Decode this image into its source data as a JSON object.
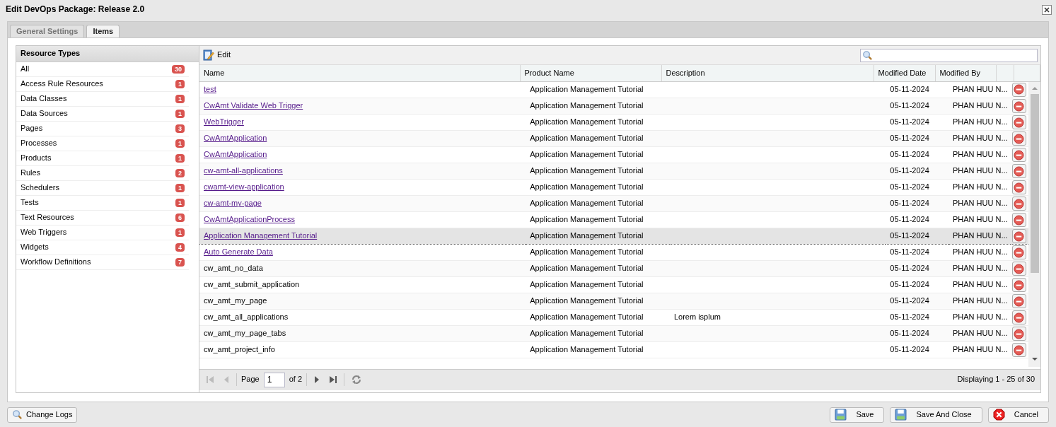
{
  "window": {
    "title": "Edit DevOps Package: Release 2.0"
  },
  "tabs": [
    {
      "label": "General Settings",
      "selected": false
    },
    {
      "label": "Items",
      "selected": true
    }
  ],
  "resource_types": {
    "title": "Resource Types",
    "items": [
      {
        "label": "All",
        "count": "30",
        "selected": false
      },
      {
        "label": "Access Rule Resources",
        "count": "1",
        "selected": false
      },
      {
        "label": "Data Classes",
        "count": "1",
        "selected": false
      },
      {
        "label": "Data Sources",
        "count": "1",
        "selected": false
      },
      {
        "label": "Pages",
        "count": "3",
        "selected": false
      },
      {
        "label": "Processes",
        "count": "1",
        "selected": false
      },
      {
        "label": "Products",
        "count": "1",
        "selected": false
      },
      {
        "label": "Rules",
        "count": "2",
        "selected": false
      },
      {
        "label": "Schedulers",
        "count": "1",
        "selected": false
      },
      {
        "label": "Tests",
        "count": "1",
        "selected": false
      },
      {
        "label": "Text Resources",
        "count": "6",
        "selected": false
      },
      {
        "label": "Web Triggers",
        "count": "1",
        "selected": false
      },
      {
        "label": "Widgets",
        "count": "4",
        "selected": false
      },
      {
        "label": "Workflow Definitions",
        "count": "7",
        "selected": false
      }
    ]
  },
  "toolbar": {
    "edit": "Edit"
  },
  "table": {
    "columns": [
      "Name",
      "Product Name",
      "Description",
      "Modified Date",
      "Modified By"
    ],
    "rows": [
      {
        "name": "test",
        "kind": "link",
        "product": "Application Management Tutorial",
        "description": "",
        "date": "05-11-2024",
        "by": "PHAN HUU N...",
        "selected": false
      },
      {
        "name": "CwAmt Validate Web Trigger",
        "kind": "link",
        "product": "Application Management Tutorial",
        "description": "",
        "date": "05-11-2024",
        "by": "PHAN HUU N...",
        "selected": false
      },
      {
        "name": "WebTrigger",
        "kind": "link",
        "product": "Application Management Tutorial",
        "description": "",
        "date": "05-11-2024",
        "by": "PHAN HUU N...",
        "selected": false
      },
      {
        "name": "CwAmtApplication",
        "kind": "link",
        "product": "Application Management Tutorial",
        "description": "",
        "date": "05-11-2024",
        "by": "PHAN HUU N...",
        "selected": false
      },
      {
        "name": "CwAmtApplication",
        "kind": "link",
        "product": "Application Management Tutorial",
        "description": "",
        "date": "05-11-2024",
        "by": "PHAN HUU N...",
        "selected": false
      },
      {
        "name": "cw-amt-all-applications",
        "kind": "link",
        "product": "Application Management Tutorial",
        "description": "",
        "date": "05-11-2024",
        "by": "PHAN HUU N...",
        "selected": false
      },
      {
        "name": "cwamt-view-application",
        "kind": "link",
        "product": "Application Management Tutorial",
        "description": "",
        "date": "05-11-2024",
        "by": "PHAN HUU N...",
        "selected": false
      },
      {
        "name": "cw-amt-my-page",
        "kind": "link",
        "product": "Application Management Tutorial",
        "description": "",
        "date": "05-11-2024",
        "by": "PHAN HUU N...",
        "selected": false
      },
      {
        "name": "CwAmtApplicationProcess",
        "kind": "link",
        "product": "Application Management Tutorial",
        "description": "",
        "date": "05-11-2024",
        "by": "PHAN HUU N...",
        "selected": false
      },
      {
        "name": "Application Management Tutorial",
        "kind": "link",
        "product": "Application Management Tutorial",
        "description": "",
        "date": "05-11-2024",
        "by": "PHAN HUU N...",
        "selected": true
      },
      {
        "name": "Auto Generate Data",
        "kind": "link",
        "product": "Application Management Tutorial",
        "description": "",
        "date": "05-11-2024",
        "by": "PHAN HUU N...",
        "selected": false
      },
      {
        "name": "cw_amt_no_data",
        "kind": "text",
        "product": "Application Management Tutorial",
        "description": "",
        "date": "05-11-2024",
        "by": "PHAN HUU N...",
        "selected": false
      },
      {
        "name": "cw_amt_submit_application",
        "kind": "text",
        "product": "Application Management Tutorial",
        "description": "",
        "date": "05-11-2024",
        "by": "PHAN HUU N...",
        "selected": false
      },
      {
        "name": "cw_amt_my_page",
        "kind": "text",
        "product": "Application Management Tutorial",
        "description": "",
        "date": "05-11-2024",
        "by": "PHAN HUU N...",
        "selected": false
      },
      {
        "name": "cw_amt_all_applications",
        "kind": "text",
        "product": "Application Management Tutorial",
        "description": "Lorem isplum",
        "date": "05-11-2024",
        "by": "PHAN HUU N...",
        "selected": false
      },
      {
        "name": "cw_amt_my_page_tabs",
        "kind": "text",
        "product": "Application Management Tutorial",
        "description": "",
        "date": "05-11-2024",
        "by": "PHAN HUU N...",
        "selected": false
      },
      {
        "name": "cw_amt_project_info",
        "kind": "text",
        "product": "Application Management Tutorial",
        "description": "",
        "date": "05-11-2024",
        "by": "PHAN HUU N...",
        "selected": false
      }
    ]
  },
  "paging": {
    "page_label": "Page",
    "page": "1",
    "of": "of 2",
    "displaying": "Displaying 1 - 25 of 30"
  },
  "footer": {
    "change_logs": "Change Logs",
    "buttons": [
      {
        "kind": "save",
        "label": "Save"
      },
      {
        "kind": "save",
        "label": "Save And Close"
      },
      {
        "kind": "cancel",
        "label": "Cancel"
      }
    ]
  }
}
